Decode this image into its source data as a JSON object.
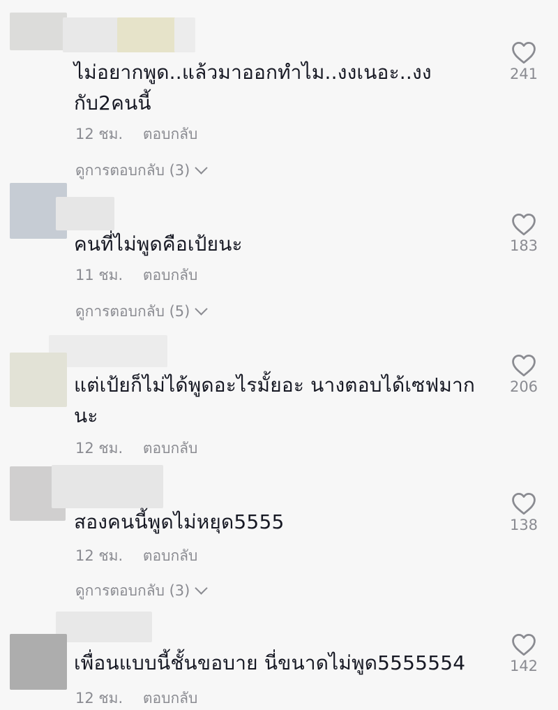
{
  "comments": [
    {
      "text": "ไม่อยากพูด..แล้วมาออกทำไม..งงเนอะ..งง กับ2คนนี้",
      "time": "12 ชม.",
      "reply": "ตอบกลับ",
      "view_replies": "ดูการตอบกลับ (3)",
      "likes": "241"
    },
    {
      "text": "คนที่ไม่พูดคือเป้ยนะ",
      "time": "11 ชม.",
      "reply": "ตอบกลับ",
      "view_replies": "ดูการตอบกลับ (5)",
      "likes": "183"
    },
    {
      "text": "แต่เป้ยก็ไม่ได้พูดอะไรมั้ยอะ นางตอบได้เซฟมาก นะ",
      "time": "12 ชม.",
      "reply": "ตอบกลับ",
      "likes": "206"
    },
    {
      "text": "สองคนนี้พูดไม่หยุด5555",
      "time": "12 ชม.",
      "reply": "ตอบกลับ",
      "view_replies": "ดูการตอบกลับ (3)",
      "likes": "138"
    },
    {
      "text": "เพื่อนแบบนี้ชั้นขอบาย นี่ขนาดไม่พูด5555554",
      "time": "12 ชม.",
      "reply": "ตอบกลับ",
      "likes": "142"
    }
  ],
  "icons": {
    "like": "heart-outline-icon"
  },
  "colors": {
    "background": "#f7f7f7",
    "text": "#161823",
    "muted": "#8a8b91"
  }
}
